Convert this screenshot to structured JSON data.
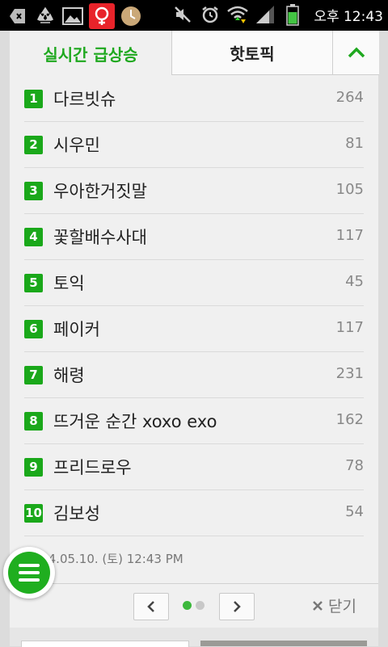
{
  "status_bar": {
    "time": "오후 12:43",
    "icons": [
      "back-icon",
      "recycle-icon",
      "image-icon",
      "app-notification-icon",
      "clock-app-icon",
      "mute-icon",
      "alarm-icon",
      "wifi-icon",
      "signal-icon",
      "battery-icon"
    ]
  },
  "tabs": {
    "active": "실시간 급상승",
    "inactive": "핫토픽",
    "toggle_icon": "chevron-up-icon"
  },
  "keywords": [
    {
      "rank": "1",
      "keyword": "다르빗슈",
      "count": "264"
    },
    {
      "rank": "2",
      "keyword": "시우민",
      "count": "81"
    },
    {
      "rank": "3",
      "keyword": "우아한거짓말",
      "count": "105"
    },
    {
      "rank": "4",
      "keyword": "꽃할배수사대",
      "count": "117"
    },
    {
      "rank": "5",
      "keyword": "토익",
      "count": "45"
    },
    {
      "rank": "6",
      "keyword": "페이커",
      "count": "117"
    },
    {
      "rank": "7",
      "keyword": "해령",
      "count": "231"
    },
    {
      "rank": "8",
      "keyword": "뜨거운 순간 xoxo exo",
      "count": "162"
    },
    {
      "rank": "9",
      "keyword": "프리드로우",
      "count": "78"
    },
    {
      "rank": "10",
      "keyword": "김보성",
      "count": "54"
    }
  ],
  "timestamp": "2014.05.10. (토) 12:43 PM",
  "footer": {
    "close_label": "닫기",
    "page_dots": [
      {
        "active": true
      },
      {
        "active": false
      }
    ]
  },
  "colors": {
    "accent_green": "#1fa81f",
    "rise_red": "#e81e1e",
    "count_gray": "#888888"
  }
}
